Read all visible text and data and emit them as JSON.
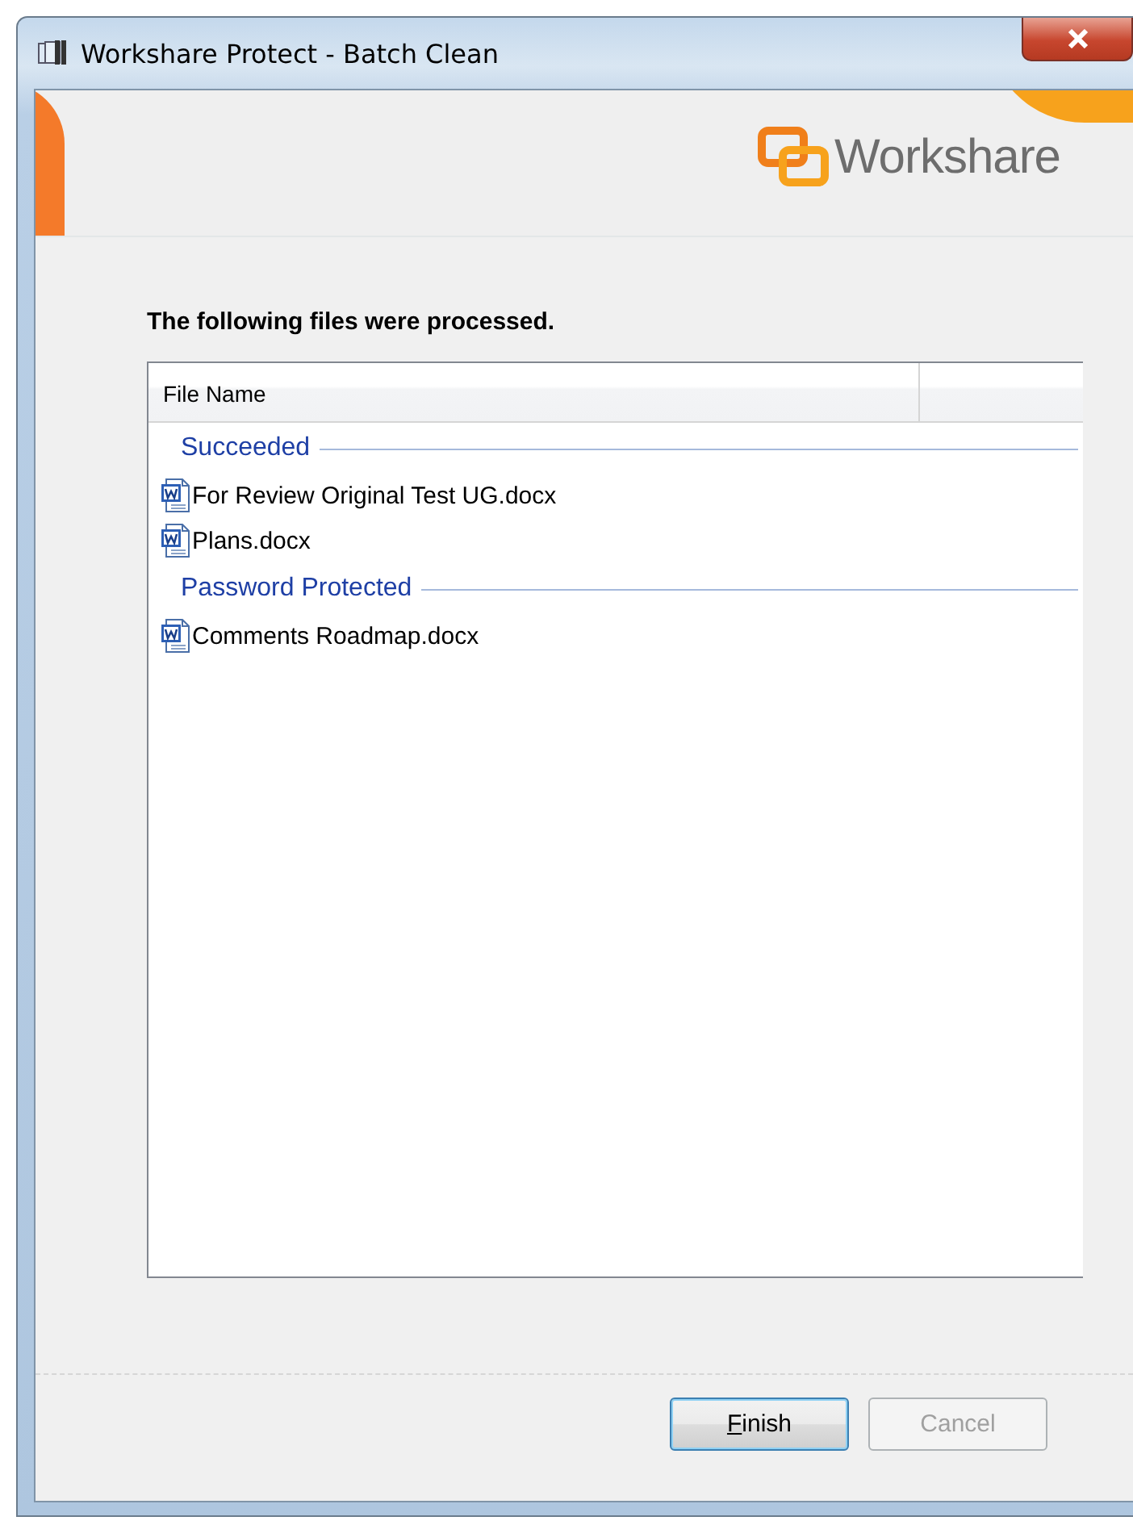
{
  "window": {
    "title": "Workshare Protect - Batch Clean"
  },
  "logo": {
    "text": "Workshare"
  },
  "heading": "The following files were processed.",
  "file_list": {
    "columns": [
      "File Name"
    ],
    "groups": [
      {
        "label": "Succeeded",
        "files": [
          "For Review Original Test UG.docx",
          "Plans.docx"
        ]
      },
      {
        "label": "Password Protected",
        "files": [
          "Comments Roadmap.docx"
        ]
      }
    ]
  },
  "buttons": [
    {
      "label": "Finish",
      "first_letter_underlined": true,
      "default": true,
      "disabled": false
    },
    {
      "label": "Cancel",
      "default": false,
      "disabled": true
    }
  ]
}
